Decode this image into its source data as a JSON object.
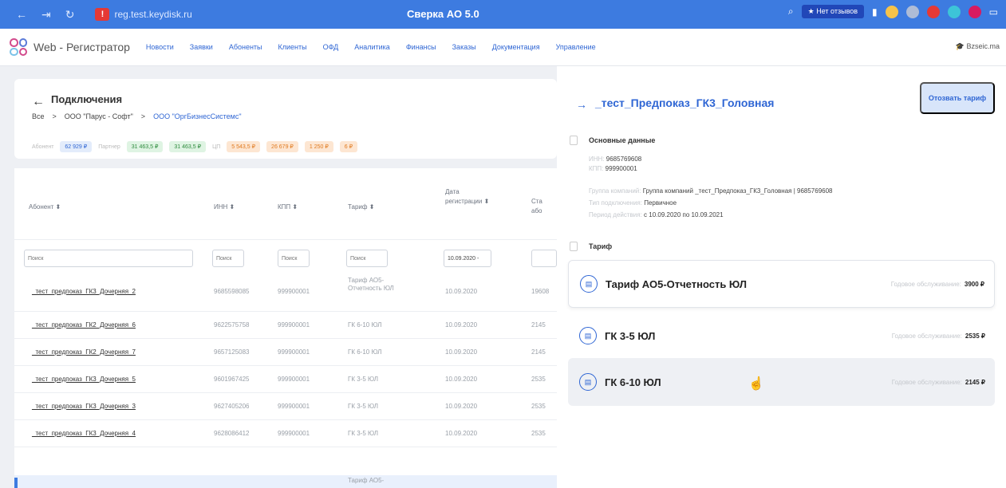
{
  "browser": {
    "url": "reg.test.keydisk.ru",
    "title": "Сверка АО 5.0",
    "badge": "★ Нет отзывов",
    "warning_icon": "warning-icon"
  },
  "appnav": {
    "brand": "Web - Регистратор",
    "menu": [
      "Новости",
      "Заявки",
      "Абоненты",
      "Клиенты",
      "ОФД",
      "Аналитика",
      "Финансы",
      "Заказы",
      "Документация",
      "Управление"
    ],
    "user": "Bzseic.ma"
  },
  "left": {
    "back_arrow": "←",
    "title": "Подключения",
    "breadcrumb": [
      "Все",
      ">",
      "ООО \"Парус - Софт\"",
      ">",
      "ООО \"ОргБизнесСистемс\""
    ],
    "chips": [
      {
        "label": "Абонент",
        "values": [
          "62 929 ₽"
        ]
      },
      {
        "label": "Партнер",
        "values": [
          "31 463,5 ₽",
          "31 463,5 ₽"
        ]
      },
      {
        "label": "ЦП",
        "values": [
          "5 543,5 ₽",
          "26 679 ₽",
          "1 250 ₽",
          "6 ₽"
        ]
      }
    ],
    "columns": [
      "Абонент ⬍",
      "ИНН ⬍",
      "КПП ⬍",
      "Тариф ⬍",
      "Дата регистрации ⬍",
      "Ста або"
    ],
    "filters": {
      "abonent": "Поиск",
      "inn": "Поиск",
      "kpp": "Поиск",
      "tarif": "Поиск",
      "date": "10.09.2020 -"
    },
    "rows": [
      {
        "name": "_тест_предпоказ_ГК3_Дочерняя_2",
        "inn": "9685598085",
        "kpp": "999900001",
        "tarif": "Тариф АО5- Отчетность ЮЛ",
        "date": "10.09.2020",
        "status": "19608"
      },
      {
        "name": "_тест_предпоказ_ГК2_Дочерняя_6",
        "inn": "9622575758",
        "kpp": "999900001",
        "tarif": "ГК 6-10 ЮЛ",
        "date": "10.09.2020",
        "status": "2145"
      },
      {
        "name": "_тест_предпоказ_ГК2_Дочерняя_7",
        "inn": "9657125083",
        "kpp": "999900001",
        "tarif": "ГК 6-10 ЮЛ",
        "date": "10.09.2020",
        "status": "2145"
      },
      {
        "name": "_тест_предпоказ_ГК3_Дочерняя_5",
        "inn": "9601967425",
        "kpp": "999900001",
        "tarif": "ГК 3-5 ЮЛ",
        "date": "10.09.2020",
        "status": "2535"
      },
      {
        "name": "_тест_предпоказ_ГК3_Дочерняя_3",
        "inn": "9627405206",
        "kpp": "999900001",
        "tarif": "ГК 3-5 ЮЛ",
        "date": "10.09.2020",
        "status": "2535"
      },
      {
        "name": "_тест_предпоказ_ГК3_Дочерняя_4",
        "inn": "9628086412",
        "kpp": "999900001",
        "tarif": "ГК 3-5 ЮЛ",
        "date": "10.09.2020",
        "status": "2535"
      }
    ],
    "last_row_tarif": "Тариф АО5-"
  },
  "right": {
    "title": "_тест_Предпоказ_ГК3_Головная",
    "action": "Отозвать тариф",
    "section_main": "Основные данные",
    "inn_k": "ИНН:",
    "inn_v": "9685769608",
    "kpp_k": "КПП:",
    "kpp_v": "999900001",
    "group_k": "Группа компаний:",
    "group_v": "Группа компаний _тест_Предпоказ_ГК3_Головная | 9685769608",
    "type_k": "Тип подключения:",
    "type_v": "Первичное",
    "period_k": "Период действия:",
    "period_v": "с 10.09.2020 по 10.09.2021",
    "section_tarif": "Тариф",
    "price_label": "Годовое обслуживание:",
    "tariffs": [
      {
        "name": "Тариф АО5-Отчетность ЮЛ",
        "price": "3900 ₽"
      },
      {
        "name": "ГК 3-5 ЮЛ",
        "price": "2535 ₽"
      },
      {
        "name": "ГК 6-10 ЮЛ",
        "price": "2145 ₽"
      }
    ]
  }
}
